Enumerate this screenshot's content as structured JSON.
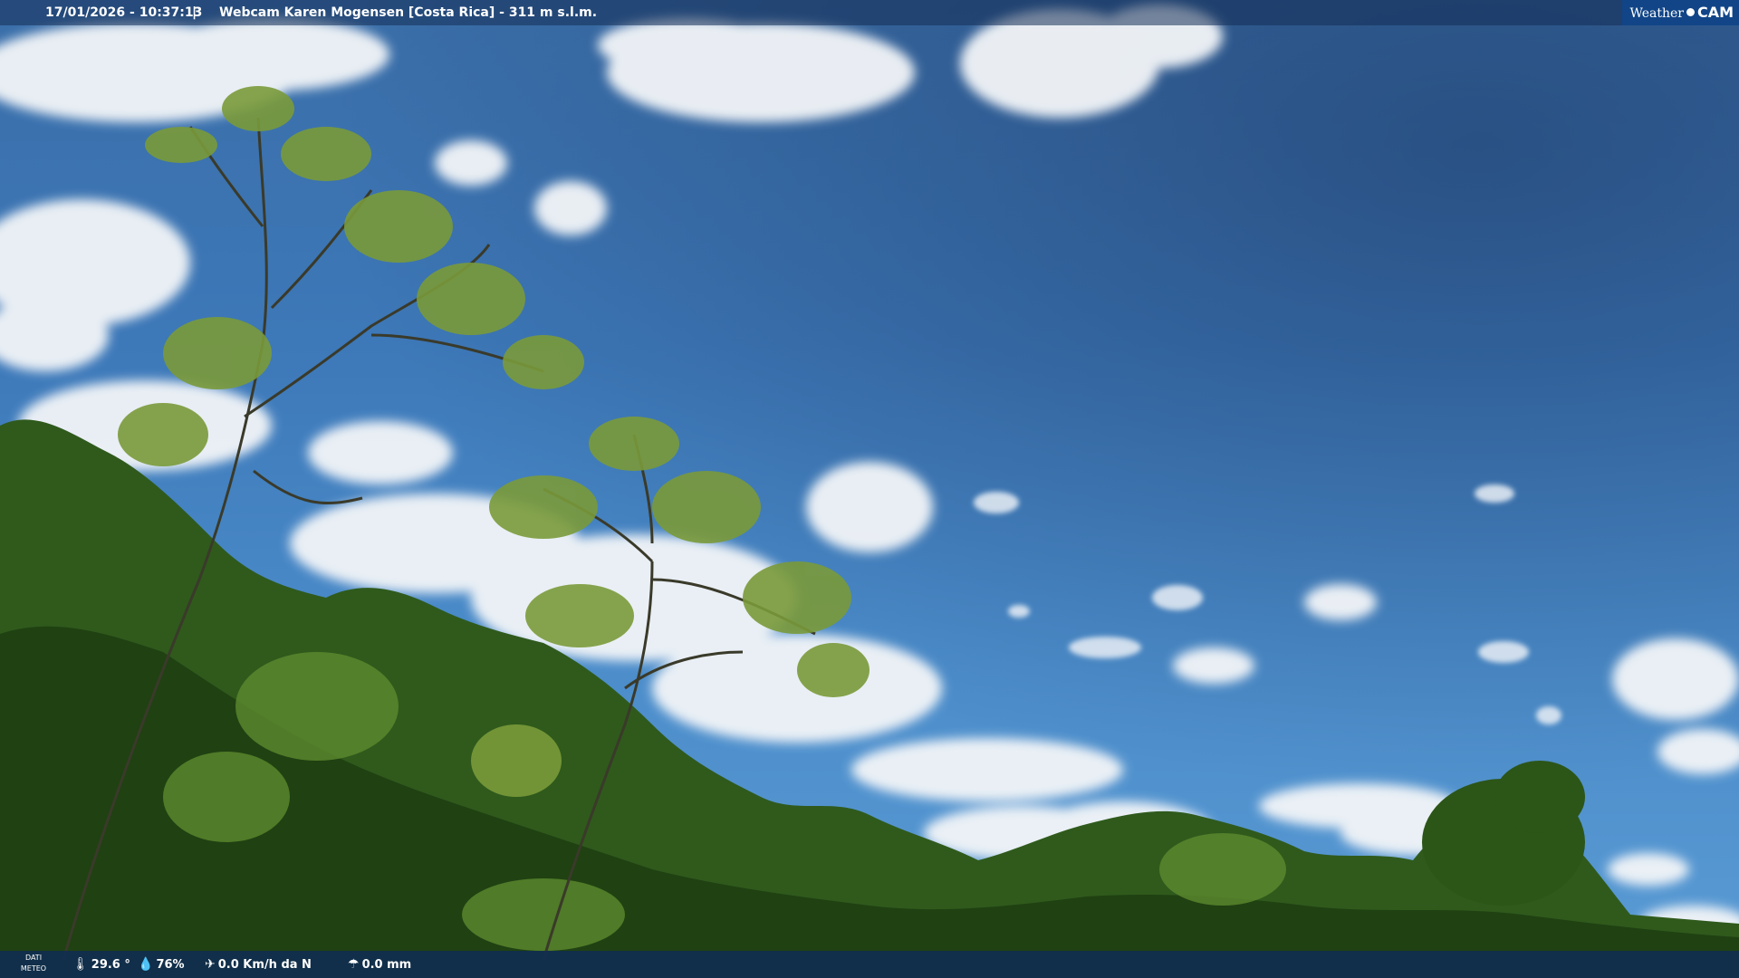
{
  "header": {
    "timestamp": "17/01/2026 - 10:37:13",
    "separator": "|",
    "title": "Webcam Karen Mogensen [Costa Rica] - 311 m s.l.m.",
    "logo_left": "Weather",
    "logo_right": "CAM"
  },
  "footer": {
    "dati_line1": "DATI",
    "dati_line2": "METEO",
    "temperature": "29.6 °",
    "humidity": "76%",
    "wind": "0.0 Km/h da N",
    "rain": "0.0 mm"
  },
  "icons": {
    "temperature": "thermometer-icon",
    "humidity": "humidity-drop-icon",
    "wind": "wind-vane-icon",
    "rain": "rain-gauge-icon"
  },
  "colors": {
    "sky": "#3d78b8",
    "bar_bg": "#142d55",
    "logo_bg": "#0f468c",
    "foliage": "#2f5a1c"
  }
}
